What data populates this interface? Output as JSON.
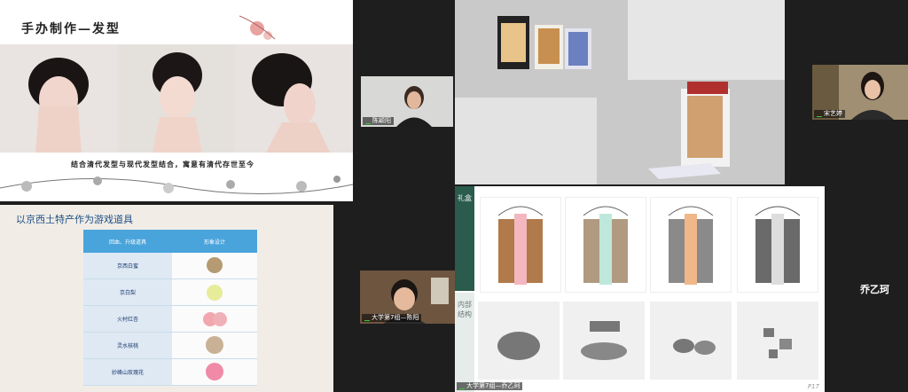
{
  "slide_craft": {
    "title": "手办制作—发型",
    "caption": "结合清代发型与现代发型结合，寓意有清代存世至今"
  },
  "slide_props": {
    "title": "以京西土特产作为游戏道具",
    "table": {
      "headers": [
        "回血、升级道具",
        "形象设计"
      ],
      "rows": [
        "京西白蜜",
        "京白梨",
        "火村红杏",
        "灵水核桃",
        "妙峰山玫瑰花"
      ]
    }
  },
  "slide_gift": {
    "side_top": "礼盒",
    "side_bottom": "内部结构",
    "page": "P17"
  },
  "participants": {
    "p1_name": "陈颖阳",
    "p2_name": "宋艺婷",
    "p3_name": "大学第7组—陈阳",
    "p4_name": "大学第7组—乔乙珂",
    "active_name": "乔乙珂"
  }
}
